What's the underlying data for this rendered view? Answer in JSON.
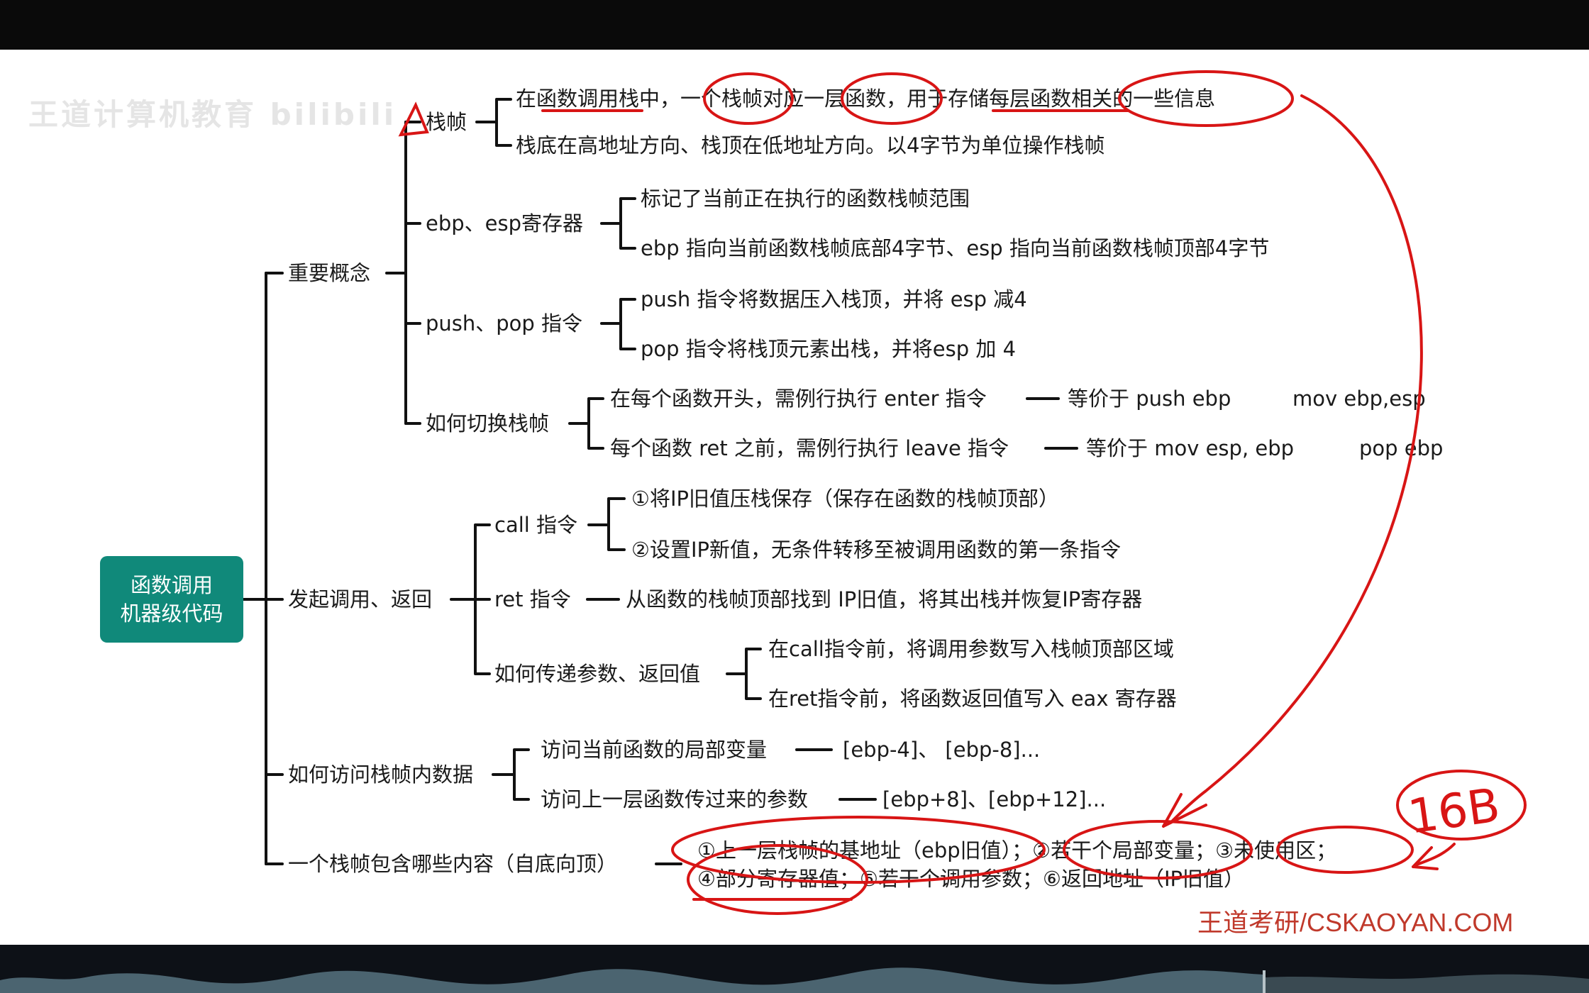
{
  "watermark": "王道计算机教育 bilibili",
  "brand": "王道考研/CSKAOYAN.COM",
  "handwriting": "16B",
  "colors": {
    "root_fill": "#10897a",
    "annotation": "#d81515",
    "brand": "#c0392b"
  },
  "root": {
    "line1": "函数调用",
    "line2": "机器级代码"
  },
  "concepts": {
    "label": "重要概念",
    "frame": {
      "label": "栈帧",
      "item1": {
        "a": "在",
        "b": "函数调用栈",
        "c": "中，",
        "d": "一个栈帧",
        "e": "对应",
        "f": "一层函数",
        "g": "，用于",
        "h": "存储每层函数",
        "i": "相关的一些信息"
      },
      "item2": "栈底在高地址方向、栈顶在低地址方向。以4字节为单位操作栈帧"
    },
    "regs": {
      "label": "ebp、esp寄存器",
      "item1": "标记了当前正在执行的函数栈帧范围",
      "item2": "ebp 指向当前函数栈帧底部4字节、esp 指向当前函数栈帧顶部4字节"
    },
    "pushpop": {
      "label": "push、pop 指令",
      "item1": "push 指令将数据压入栈顶，并将 esp 减4",
      "item2": "pop 指令将栈顶元素出栈，并将esp 加 4"
    },
    "switch": {
      "label": "如何切换栈帧",
      "item1": "在每个函数开头，需例行执行 enter 指令",
      "item1_eq": "等价于 push ebp",
      "item1_mov": "mov ebp,esp",
      "item2": "每个函数 ret 之前，需例行执行 leave 指令",
      "item2_eq": "等价于 mov esp, ebp",
      "item2_pop": "pop ebp"
    }
  },
  "callret": {
    "label": "发起调用、返回",
    "call": {
      "label": "call 指令",
      "item1": "①将IP旧值压栈保存（保存在函数的栈帧顶部）",
      "item2": "②设置IP新值，无条件转移至被调用函数的第一条指令"
    },
    "ret": {
      "label": "ret 指令",
      "item1": "从函数的栈帧顶部找到 IP旧值，将其出栈并恢复IP寄存器"
    },
    "params": {
      "label": "如何传递参数、返回值",
      "item1": "在call指令前，将调用参数写入栈帧顶部区域",
      "item2": "在ret指令前，将函数返回值写入 eax 寄存器"
    }
  },
  "access": {
    "label": "如何访问栈帧内数据",
    "local": "访问当前函数的局部变量",
    "local_val": "[ebp-4]、 [ebp-8]...",
    "param": "访问上一层函数传过来的参数",
    "param_val": "[ebp+8]、[ebp+12]..."
  },
  "contents": {
    "label": "一个栈帧包含哪些内容（自底向顶）",
    "line1": "①上一层栈帧的基地址（ebp旧值）；②若干个局部变量；③未使用区；",
    "line2": "④部分寄存器值；⑤若干个调用参数；⑥返回地址（IP旧值）"
  }
}
